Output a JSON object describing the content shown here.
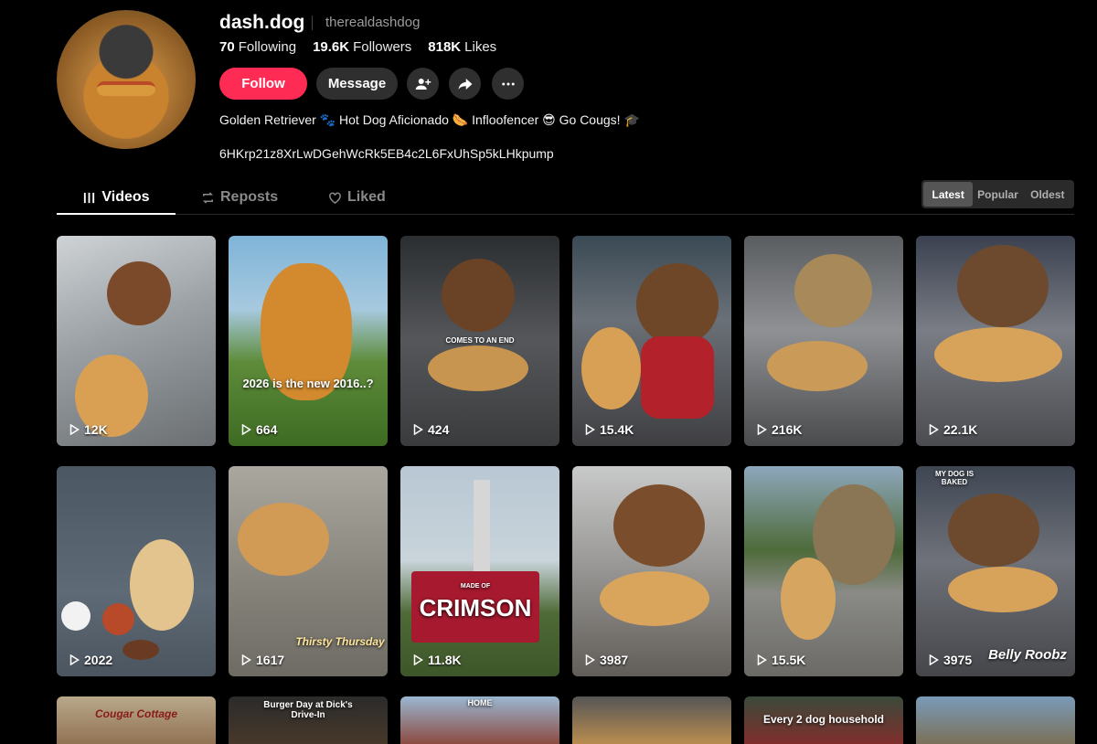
{
  "profile": {
    "username": "dash.dog",
    "handle": "therealdashdog",
    "stats": [
      {
        "value": "70",
        "label": "Following"
      },
      {
        "value": "19.6K",
        "label": "Followers"
      },
      {
        "value": "818K",
        "label": "Likes"
      }
    ],
    "follow_label": "Follow",
    "message_label": "Message",
    "bio": "Golden Retriever 🐾 Hot Dog Aficionado 🌭 Infloofencer 😎 Go Cougs! 🎓",
    "wallet": "6HKrp21z8XrLwDGehWcRk5EB4c2L6FxUhSp5kLHkpump"
  },
  "tabs": [
    {
      "label": "Videos",
      "icon": "grid-icon"
    },
    {
      "label": "Reposts",
      "icon": "repost-icon"
    },
    {
      "label": "Liked",
      "icon": "heart-icon"
    }
  ],
  "sort": [
    "Latest",
    "Popular",
    "Oldest"
  ],
  "colors": {
    "accent": "#fe2c55",
    "background": "#000000"
  },
  "videos": [
    {
      "views": "12K",
      "caption": ""
    },
    {
      "views": "664",
      "caption": "2026 is the new 2016..?"
    },
    {
      "views": "424",
      "caption": "COMES TO AN END"
    },
    {
      "views": "15.4K",
      "caption": ""
    },
    {
      "views": "216K",
      "caption": ""
    },
    {
      "views": "22.1K",
      "caption": ""
    },
    {
      "views": "2022",
      "caption": ""
    },
    {
      "views": "1617",
      "caption": "Thirsty Thursday"
    },
    {
      "views": "11.8K",
      "caption": "CRIMSON",
      "subcaption": "MADE OF"
    },
    {
      "views": "3987",
      "caption": ""
    },
    {
      "views": "15.5K",
      "caption": ""
    },
    {
      "views": "3975",
      "caption": "Belly Roobz",
      "topcaption": "MY DOG IS BAKED"
    }
  ],
  "row3_captions": [
    "Cougar Cottage",
    "Burger Day at Dick's Drive-In",
    "HOME",
    "",
    "Every 2 dog household",
    ""
  ]
}
